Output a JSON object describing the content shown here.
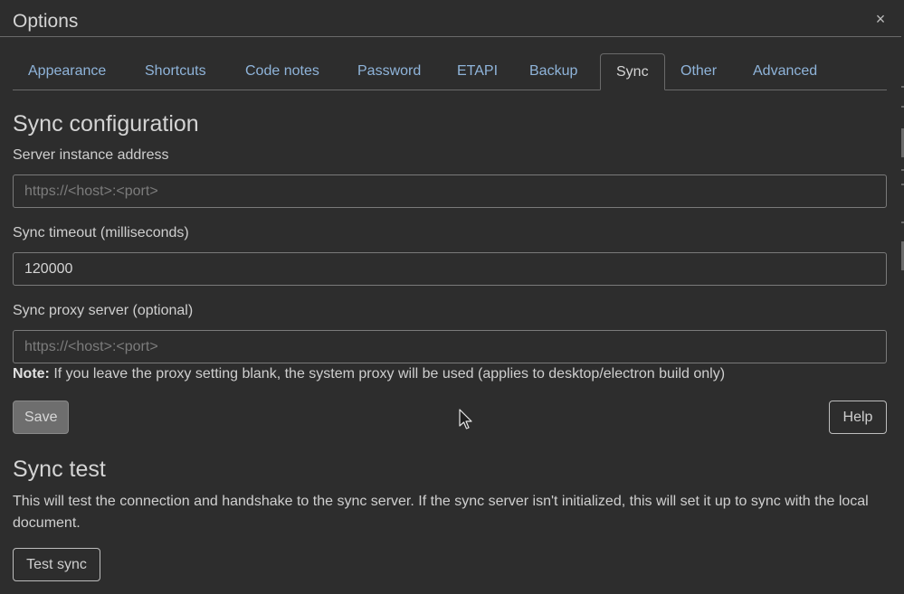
{
  "dialog": {
    "title": "Options",
    "close_glyph": "×"
  },
  "tabs": [
    {
      "label": "Appearance"
    },
    {
      "label": "Shortcuts"
    },
    {
      "label": "Code notes"
    },
    {
      "label": "Password"
    },
    {
      "label": "ETAPI"
    },
    {
      "label": "Backup"
    },
    {
      "label": "Sync",
      "active": true
    },
    {
      "label": "Other"
    },
    {
      "label": "Advanced"
    }
  ],
  "sync_config": {
    "heading": "Sync configuration",
    "server_label": "Server instance address",
    "server_value": "",
    "server_placeholder": "https://<host>:<port>",
    "timeout_label": "Sync timeout (milliseconds)",
    "timeout_value": "120000",
    "proxy_label": "Sync proxy server (optional)",
    "proxy_value": "",
    "proxy_placeholder": "https://<host>:<port>",
    "note_prefix": "Note:",
    "note_text": " If you leave the proxy setting blank, the system proxy will be used (applies to desktop/electron build only)",
    "save_label": "Save",
    "help_label": "Help"
  },
  "sync_test": {
    "heading": "Sync test",
    "description": "This will test the connection and handshake to the sync server. If the sync server isn't initialized, this will set it up to sync with the local document.",
    "button_label": "Test sync"
  },
  "colors": {
    "background": "#2d2d2d",
    "tab_link": "#8fb4da",
    "border": "#6a6a6a"
  },
  "icons": {
    "close": "close-icon",
    "pointer": "mouse-pointer-icon"
  }
}
